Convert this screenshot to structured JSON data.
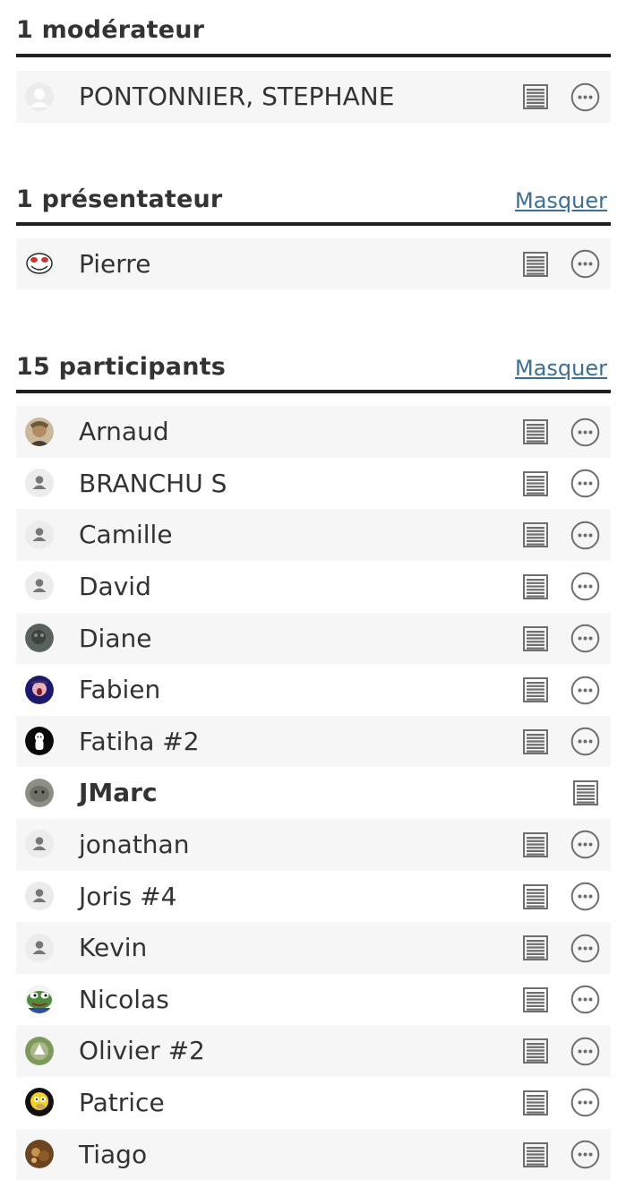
{
  "sections": {
    "moderators": {
      "title": "1 modérateur",
      "toggle": "",
      "items": [
        {
          "name": "PONTONNIER, STEPHANE",
          "avatar": "blank",
          "bold": false,
          "menu": true
        }
      ]
    },
    "presenters": {
      "title": "1 présentateur",
      "toggle": "Masquer",
      "items": [
        {
          "name": "Pierre",
          "avatar": "troll-face",
          "bold": false,
          "menu": true
        }
      ]
    },
    "participants": {
      "title": "15 participants",
      "toggle": "Masquer",
      "items": [
        {
          "name": "Arnaud",
          "avatar": "photo-man",
          "bold": false,
          "menu": true
        },
        {
          "name": "BRANCHU S",
          "avatar": "default-user",
          "bold": false,
          "menu": true
        },
        {
          "name": "Camille",
          "avatar": "default-user",
          "bold": false,
          "menu": true
        },
        {
          "name": "David",
          "avatar": "default-user",
          "bold": false,
          "menu": true
        },
        {
          "name": "Diane",
          "avatar": "photo-gray",
          "bold": false,
          "menu": true
        },
        {
          "name": "Fabien",
          "avatar": "photo-blue",
          "bold": false,
          "menu": true
        },
        {
          "name": "Fatiha #2",
          "avatar": "white-figure",
          "bold": false,
          "menu": true
        },
        {
          "name": "JMarc",
          "avatar": "photo-cat",
          "bold": true,
          "menu": false
        },
        {
          "name": "jonathan",
          "avatar": "default-user",
          "bold": false,
          "menu": true
        },
        {
          "name": "Joris #4",
          "avatar": "default-user",
          "bold": false,
          "menu": true
        },
        {
          "name": "Kevin",
          "avatar": "default-user",
          "bold": false,
          "menu": true
        },
        {
          "name": "Nicolas",
          "avatar": "pepe-frog",
          "bold": false,
          "menu": true
        },
        {
          "name": "Olivier #2",
          "avatar": "photo-green",
          "bold": false,
          "menu": true
        },
        {
          "name": "Patrice",
          "avatar": "homer",
          "bold": false,
          "menu": true
        },
        {
          "name": "Tiago",
          "avatar": "photo-brown",
          "bold": false,
          "menu": true
        }
      ]
    }
  },
  "colors": {
    "link": "#3a6f9a",
    "icon": "#6e6e6e",
    "rule": "#1f1f1f",
    "row_alt": "#f6f6f6"
  }
}
